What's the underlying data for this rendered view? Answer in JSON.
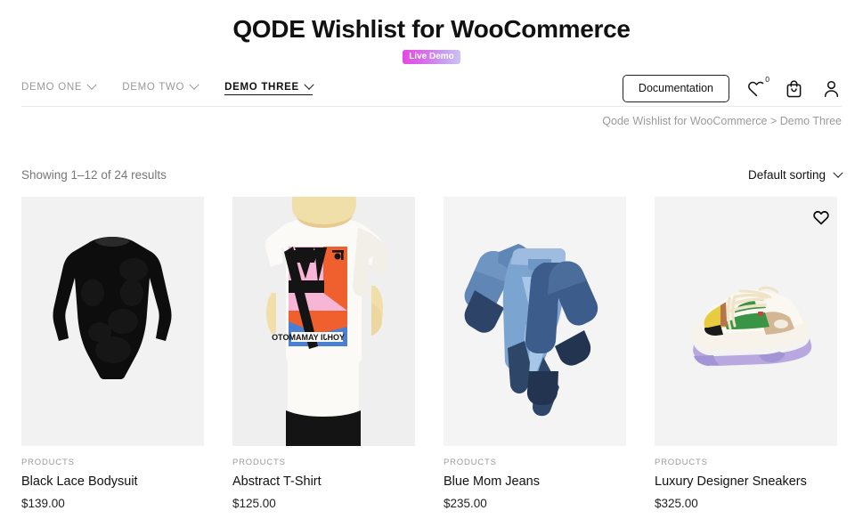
{
  "header": {
    "site_title": "QODE Wishlist for WooCommerce",
    "badge": "Live Demo",
    "badge_gradient_from": "#e548e5",
    "badge_gradient_to": "#cfc0f5"
  },
  "nav": {
    "items": [
      {
        "label": "DEMO ONE",
        "active": false,
        "icon": "chevron-down-icon"
      },
      {
        "label": "DEMO TWO",
        "active": false,
        "icon": "chevron-down-icon"
      },
      {
        "label": "DEMO THREE",
        "active": true,
        "icon": "chevron-down-icon"
      }
    ],
    "documentation_label": "Documentation",
    "wishlist_icon": "heart-icon",
    "wishlist_count": "0",
    "cart_icon": "shopping-bag-icon",
    "account_icon": "user-icon"
  },
  "breadcrumb": {
    "text": "Qode Wishlist for WooCommerce > Demo Three",
    "root": "Qode Wishlist for WooCommerce",
    "separator": ">",
    "current": "Demo Three"
  },
  "toolbar": {
    "results_text": "Showing 1–12 of 24 results",
    "sorting_label": "Default sorting",
    "sorting_icon": "chevron-down-icon",
    "sorting_options": [
      "Default sorting"
    ]
  },
  "products": [
    {
      "category": "PRODUCTS",
      "title": "Black Lace Bodysuit",
      "price": "$139.00",
      "image": "black-long-sleeve-lace-bodysuit",
      "wishlist_icon": "heart-icon"
    },
    {
      "category": "PRODUCTS",
      "title": "Abstract T-Shirt",
      "price": "$125.00",
      "image": "white-tshirt-abstract-back-print-on-model",
      "wishlist_icon": "heart-icon"
    },
    {
      "category": "PRODUCTS",
      "title": "Blue Mom Jeans",
      "price": "$235.00",
      "image": "three-pairs-blue-denim-jeans",
      "wishlist_icon": "heart-icon"
    },
    {
      "category": "PRODUCTS",
      "title": "Luxury Designer Sneakers",
      "price": "$325.00",
      "image": "chunky-cream-green-sneaker-lavender-sole",
      "wishlist_icon": "heart-icon"
    }
  ],
  "colors": {
    "text_dark": "#111111",
    "text_muted": "#9b9b9b",
    "thumb_background": "#f2f2f2",
    "divider": "#e9e9e9"
  }
}
